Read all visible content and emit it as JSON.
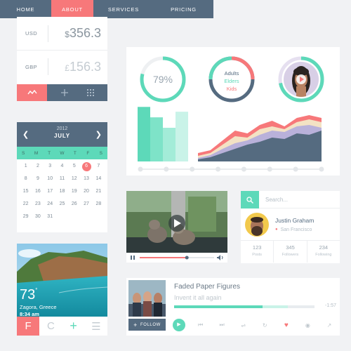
{
  "colors": {
    "navy": "#556b80",
    "coral": "#f7787a",
    "mint": "#5dd9b9",
    "background": "#f1f2f4"
  },
  "currency": {
    "rows": [
      {
        "code": "USD",
        "symbol": "$",
        "amount": "356.3"
      },
      {
        "code": "GBP",
        "symbol": "£",
        "amount": "156.3"
      }
    ],
    "icons": [
      "trend-icon",
      "plus-icon",
      "grid-icon"
    ]
  },
  "nav": {
    "items": [
      {
        "label": "HOME"
      },
      {
        "label": "ABOUT",
        "active": true
      },
      {
        "label": "SERVICES"
      },
      {
        "label": "PRICING"
      }
    ]
  },
  "dashboard": {
    "gauge": {
      "label": "79%",
      "fraction": 0.79
    },
    "legend": [
      {
        "label": "Adults",
        "color": "#556b80"
      },
      {
        "label": "Elders",
        "color": "#5dd9b9"
      },
      {
        "label": "Kids",
        "color": "#f7787a"
      }
    ],
    "profile_ring": {
      "fraction": 0.72,
      "icon": "play-icon"
    },
    "bars": [
      {
        "value": 68,
        "color": "#5dd9b9"
      },
      {
        "value": 55,
        "color": "#7ee3c8"
      },
      {
        "value": 42,
        "color": "#a3ecd8"
      },
      {
        "value": 62,
        "color": "#c9f3e8"
      }
    ],
    "area_series": [
      {
        "color": "#f7787a",
        "values": [
          12,
          16,
          30,
          44,
          40,
          52,
          58,
          50,
          62,
          66,
          62
        ]
      },
      {
        "color": "#f3e2c4",
        "values": [
          8,
          12,
          24,
          36,
          34,
          46,
          50,
          46,
          56,
          60,
          56
        ]
      },
      {
        "color": "#b9b1da",
        "values": [
          5,
          9,
          18,
          26,
          30,
          38,
          44,
          42,
          50,
          52,
          48
        ]
      },
      {
        "color": "#556b80",
        "values": [
          3,
          6,
          12,
          18,
          24,
          28,
          34,
          32,
          40,
          38,
          44
        ]
      }
    ],
    "timeline_points": 8
  },
  "calendar": {
    "year": "2012",
    "month": "JULY",
    "weekdays": [
      "S",
      "M",
      "T",
      "W",
      "T",
      "F",
      "S"
    ],
    "days": [
      "1",
      "2",
      "3",
      "4",
      "5",
      "6",
      "7",
      "8",
      "9",
      "10",
      "11",
      "12",
      "13",
      "14",
      "15",
      "16",
      "17",
      "18",
      "19",
      "20",
      "21",
      "22",
      "23",
      "24",
      "25",
      "26",
      "27",
      "28",
      "29",
      "30",
      "31"
    ],
    "today": "6"
  },
  "video": {
    "progress": 0.6,
    "icons": [
      "play-icon",
      "pause-icon",
      "volume-icon"
    ]
  },
  "search": {
    "placeholder": "Search..."
  },
  "profile": {
    "name": "Justin Graham",
    "location": "San Francisco",
    "stats": [
      {
        "value": "123",
        "label": "Posts"
      },
      {
        "value": "345",
        "label": "Followers"
      },
      {
        "value": "234",
        "label": "Following"
      }
    ]
  },
  "weather": {
    "temp": "73",
    "degree": "°",
    "city": "Zagora, Greece",
    "time": "8:34 am",
    "bar": [
      "F",
      "C",
      "+",
      "☰"
    ]
  },
  "player": {
    "title": "Faded Paper Figures",
    "subtitle": "Invent it all again",
    "time": "-1:57",
    "progress": 0.63,
    "buffered": 0.81,
    "follow_label": "FOLLOW",
    "controls": [
      "prev-icon",
      "next-icon",
      "shuffle-icon",
      "repeat-icon",
      "heart-icon",
      "target-icon",
      "share-icon"
    ]
  }
}
